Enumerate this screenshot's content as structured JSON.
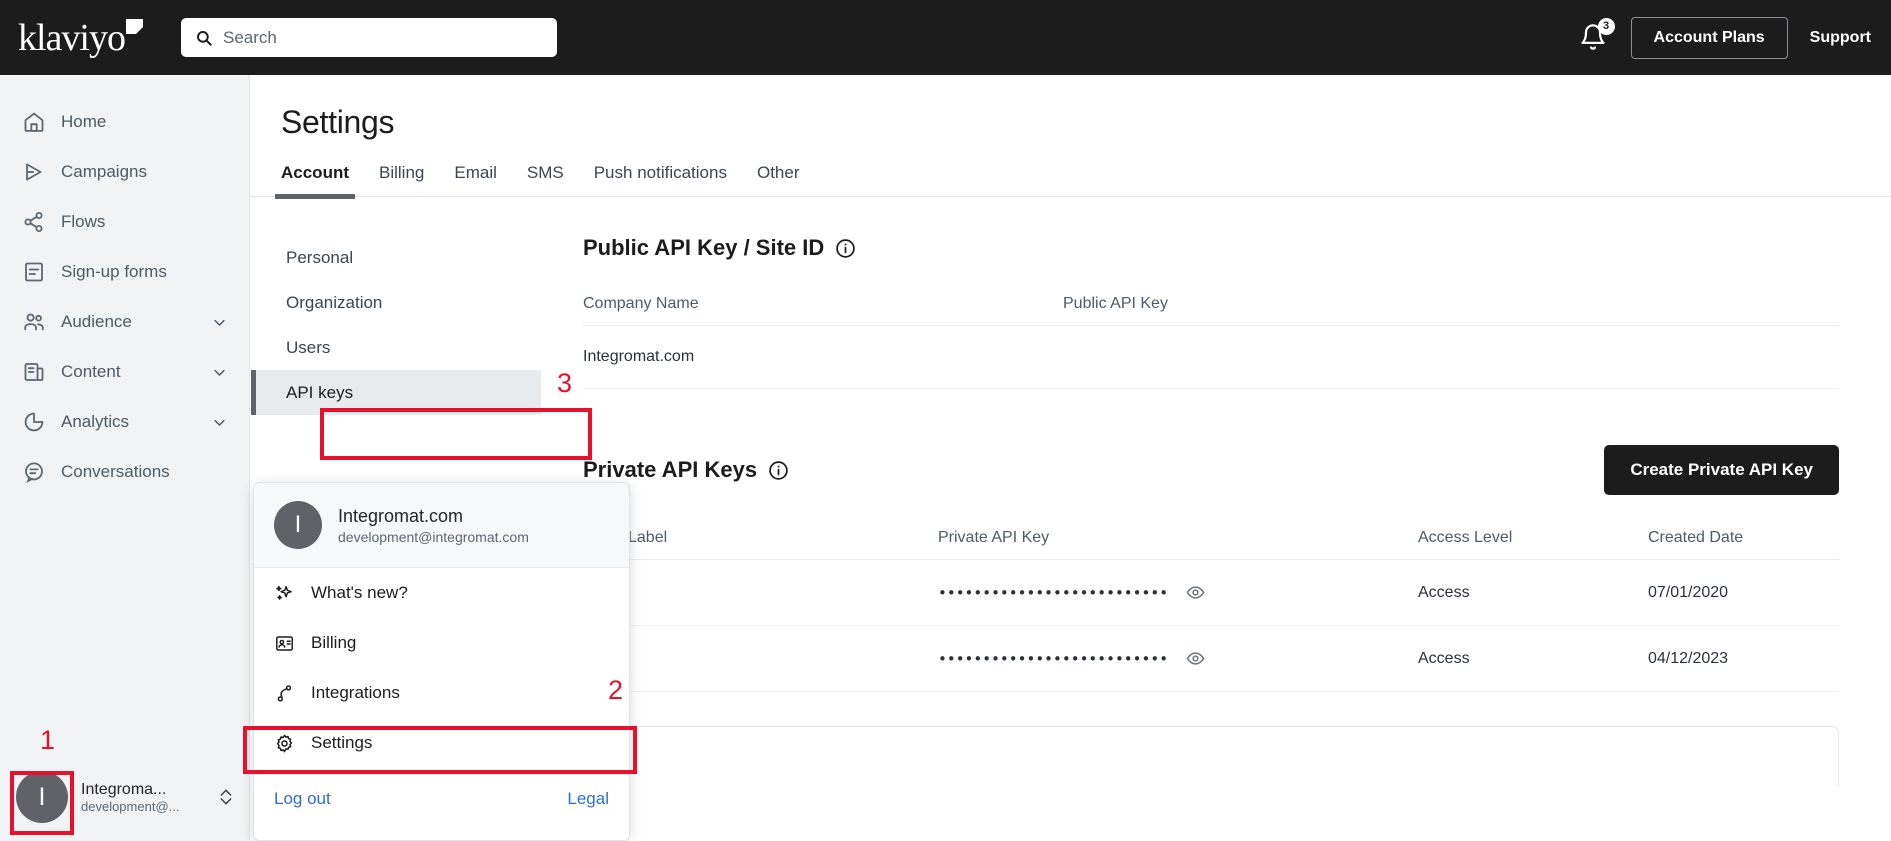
{
  "brand": {
    "logo_text": "klaviyo",
    "accent": "#1c1c1c",
    "annotation_color": "#e8112d"
  },
  "header": {
    "search": {
      "placeholder": "Search",
      "value": "",
      "icon": "search-icon"
    },
    "notifications": {
      "count": "3",
      "icon": "bell-icon"
    },
    "account_plans_label": "Account Plans",
    "support_label": "Support"
  },
  "sidebar": {
    "items": [
      {
        "label": "Home",
        "icon": "home-icon",
        "expandable": false
      },
      {
        "label": "Campaigns",
        "icon": "campaigns-icon",
        "expandable": false
      },
      {
        "label": "Flows",
        "icon": "flows-icon",
        "expandable": false
      },
      {
        "label": "Sign-up forms",
        "icon": "signup-forms-icon",
        "expandable": false
      },
      {
        "label": "Audience",
        "icon": "audience-icon",
        "expandable": true
      },
      {
        "label": "Content",
        "icon": "content-icon",
        "expandable": true
      },
      {
        "label": "Analytics",
        "icon": "analytics-icon",
        "expandable": true
      },
      {
        "label": "Conversations",
        "icon": "conversations-icon",
        "expandable": false
      }
    ],
    "account": {
      "initial": "I",
      "name": "Integroma...",
      "email": "development@...",
      "switch_icon": "chevron-up-down-icon"
    }
  },
  "main": {
    "title": "Settings",
    "tabs": [
      {
        "label": "Account",
        "active": true
      },
      {
        "label": "Billing",
        "active": false
      },
      {
        "label": "Email",
        "active": false
      },
      {
        "label": "SMS",
        "active": false
      },
      {
        "label": "Push notifications",
        "active": false
      },
      {
        "label": "Other",
        "active": false
      }
    ],
    "subnav": [
      {
        "label": "Personal",
        "selected": false
      },
      {
        "label": "Organization",
        "selected": false
      },
      {
        "label": "Users",
        "selected": false
      },
      {
        "label": "API keys",
        "selected": true
      }
    ],
    "public_key_section": {
      "title": "Public API Key / Site ID",
      "info_icon": "info-icon",
      "columns": [
        "Company Name",
        "Public API Key"
      ],
      "rows": [
        {
          "company_name": "Integromat.com",
          "public_api_key": ""
        }
      ]
    },
    "private_keys_section": {
      "title": "Private API Keys",
      "info_icon": "info-icon",
      "create_button_label": "Create Private API Key",
      "columns": [
        "",
        "Label",
        "Private API Key",
        "Access Level",
        "Created Date"
      ],
      "rows": [
        {
          "expand_icon": "chevron-down-icon",
          "label": "",
          "key_masked": "••••••••••••••••••••••••••",
          "reveal_icon": "eye-icon",
          "access_level": "Access",
          "created_date": "07/01/2020"
        },
        {
          "expand_icon": "chevron-down-icon",
          "label": "",
          "key_masked": "••••••••••••••••••••••••••",
          "reveal_icon": "eye-icon",
          "access_level": "Access",
          "created_date": "04/12/2023"
        }
      ]
    }
  },
  "account_popup": {
    "initial": "I",
    "name": "Integromat.com",
    "email": "development@integromat.com",
    "items": [
      {
        "label": "What's new?",
        "icon": "sparkles-icon"
      },
      {
        "label": "Billing",
        "icon": "billing-card-icon"
      },
      {
        "label": "Integrations",
        "icon": "integrations-icon"
      },
      {
        "label": "Settings",
        "icon": "gear-icon"
      }
    ],
    "logout_label": "Log out",
    "legal_label": "Legal"
  },
  "annotations": [
    {
      "number": "1",
      "target": "sidebar-account-avatar"
    },
    {
      "number": "2",
      "target": "popup-settings-item"
    },
    {
      "number": "3",
      "target": "subnav-api-keys"
    }
  ]
}
